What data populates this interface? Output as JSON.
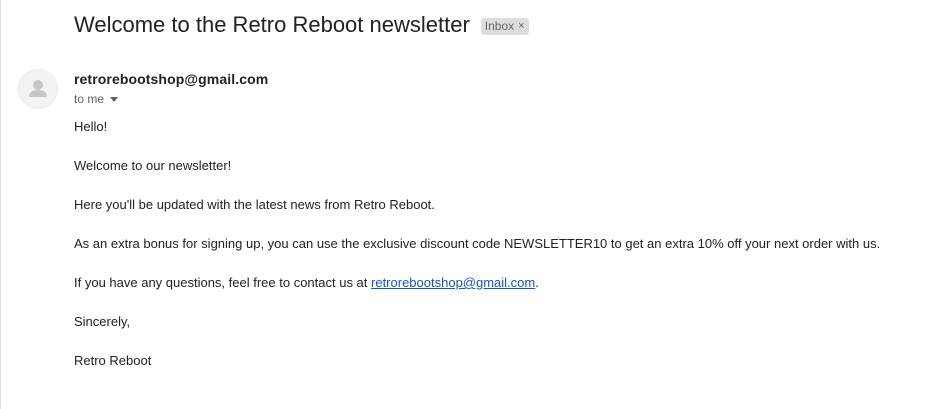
{
  "email": {
    "subject": "Welcome to the Retro Reboot newsletter",
    "label": "Inbox",
    "label_close": "×",
    "sender": "retrorebootshop@gmail.com",
    "recipient": "to me",
    "avatar_icon": "person-icon",
    "body": {
      "greeting": "Hello!",
      "welcome": "Welcome to our newsletter!",
      "updates": "Here you'll be updated with the latest news from Retro Reboot.",
      "bonus": "As an extra bonus for signing up, you can use the exclusive discount code NEWSLETTER10 to get an extra 10% off your next order with us.",
      "contact_prefix": "If you have any questions, feel free to contact us at ",
      "contact_email": "retrorebootshop@gmail.com",
      "contact_suffix": ".",
      "signoff": "Sincerely,",
      "signature": "Retro Reboot"
    }
  },
  "colors": {
    "link": "#1155cc",
    "chip_bg": "#dddddd",
    "text": "#222222"
  }
}
